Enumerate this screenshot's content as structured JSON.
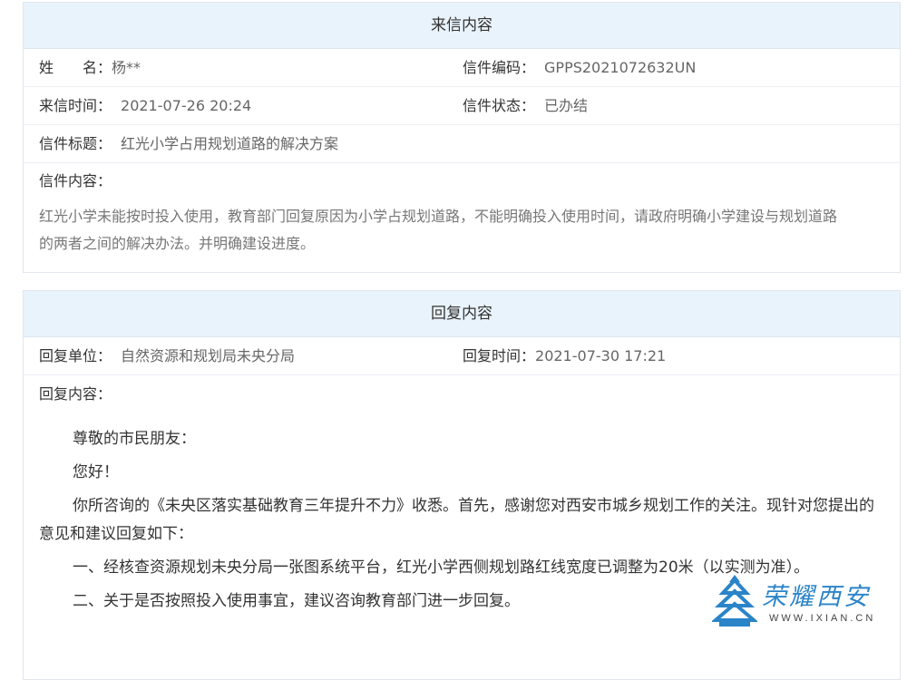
{
  "letter": {
    "header": "来信内容",
    "name_label": "姓　　名：",
    "name_value": "杨**",
    "code_label": "信件编码：",
    "code_value": "GPPS2021072632UN",
    "time_label": "来信时间：",
    "time_value": "2021-07-26 20:24",
    "status_label": "信件状态：",
    "status_value": "已办结",
    "subject_label": "信件标题：",
    "subject_value": "红光小学占用规划道路的解决方案",
    "content_label": "信件内容：",
    "content_line1": "红光小学未能按时投入使用，教育部门回复原因为小学占规划道路，不能明确投入使用时间，请政府明确小学建设与规划道路",
    "content_line2": "的两者之间的解决办法。并明确建设进度。"
  },
  "reply": {
    "header": "回复内容",
    "unit_label": "回复单位：",
    "unit_value": "自然资源和规划局未央分局",
    "time_label": "回复时间：",
    "time_value": "2021-07-30 17:21",
    "content_label": "回复内容：",
    "greeting": "尊敬的市民朋友：",
    "hello": "您好！",
    "para1": "你所咨询的《未央区落实基础教育三年提升不力》收悉。首先，感谢您对西安市城乡规划工作的关注。现针对您提出的意见和建议回复如下：",
    "para2": "一、经核查资源规划未央分局一张图系统平台，红光小学西侧规划路红线宽度已调整为20米（以实测为准）。",
    "para3": "二、关于是否按照投入使用事宜，建议咨询教育部门进一步回复。"
  },
  "watermark": {
    "name": "荣耀西安",
    "url": "WWW.IXIAN.CN",
    "color": "#2a84c8"
  }
}
